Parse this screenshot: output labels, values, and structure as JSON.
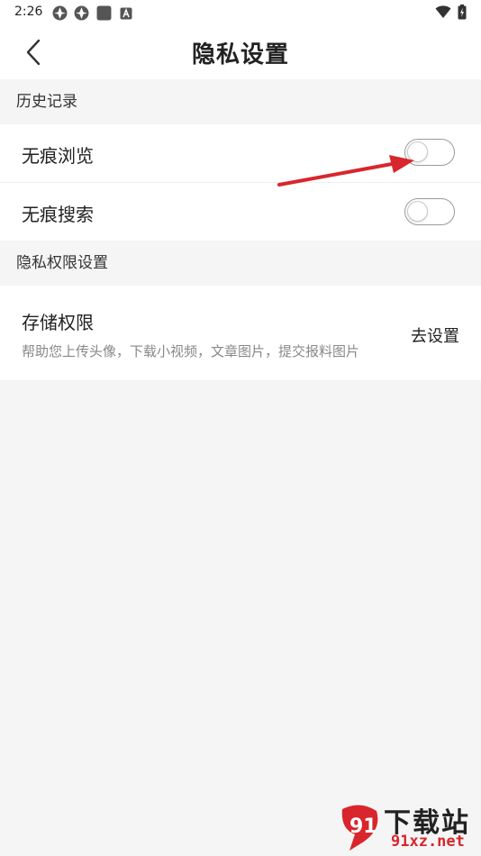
{
  "status_bar": {
    "time": "2:26"
  },
  "header": {
    "title": "隐私设置"
  },
  "sections": [
    {
      "title": "历史记录"
    },
    {
      "title": "隐私权限设置"
    }
  ],
  "history": {
    "incognito_browse": {
      "label": "无痕浏览",
      "enabled": false
    },
    "incognito_search": {
      "label": "无痕搜索",
      "enabled": false
    }
  },
  "permissions": {
    "storage": {
      "label": "存储权限",
      "description": "帮助您上传头像，下载小视频，文章图片，提交报料图片",
      "action_label": "去设置"
    }
  },
  "watermark": {
    "main": "下载站",
    "sub": "91xz.net"
  },
  "colors": {
    "annotation_arrow": "#d8262c",
    "background": "#f5f5f5"
  }
}
